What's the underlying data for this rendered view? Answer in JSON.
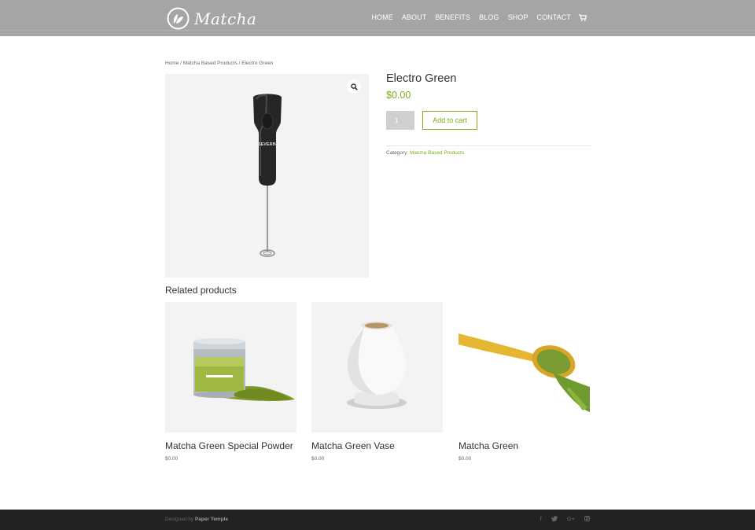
{
  "header": {
    "logo_text": "Matcha",
    "nav": [
      "HOME",
      "ABOUT",
      "BENEFITS",
      "BLOG",
      "SHOP",
      "CONTACT"
    ]
  },
  "breadcrumb": {
    "home": "Home",
    "category": "Matcha Based Products",
    "current": "Electro Green",
    "separator": " / "
  },
  "product": {
    "title": "Electro Green",
    "price": "$0.00",
    "quantity": "1",
    "add_to_cart": "Add to cart",
    "category_label": "Category:",
    "category": "Matcha Based Products",
    "image_brand": "SEVERIN"
  },
  "related": {
    "title": "Related products",
    "items": [
      {
        "name": "Matcha Green Special Powder",
        "price": "$0.00"
      },
      {
        "name": "Matcha Green Vase",
        "price": "$0.00"
      },
      {
        "name": "Matcha Green",
        "price": "$0.00"
      }
    ]
  },
  "footer": {
    "designed_by": "Designed by",
    "designer": "Paper Temple",
    "social": [
      "f",
      "t",
      "G+",
      "ig"
    ]
  },
  "colors": {
    "accent": "#7cac1a",
    "header_bg": "#a5a5a5",
    "footer_bg": "#222222"
  },
  "icons": {
    "zoom": "magnifier-icon",
    "cart": "cart-icon",
    "logo": "leaf-icon"
  }
}
